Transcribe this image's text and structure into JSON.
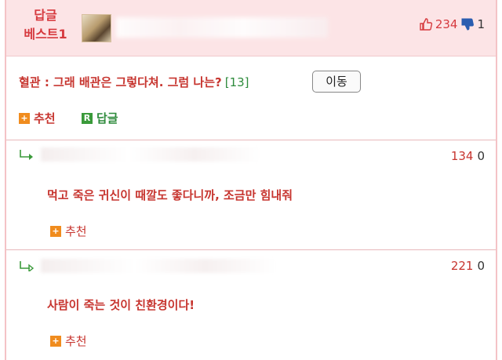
{
  "best": {
    "label_line1": "답글",
    "label_line2": "베스트1",
    "votes_up": "234",
    "votes_down": "1"
  },
  "reply": {
    "text": "혈관 : 그래 배관은 그렇다쳐. 그럼 나는?",
    "reply_count": "[13]",
    "move_button": "이동",
    "recommend_label": "추천",
    "reply_label": "답글",
    "plus_icon": "+",
    "r_icon": "R"
  },
  "subreplies": [
    {
      "text": "먹고 죽은 귀신이 때깔도 좋다니까, 조금만 힘내줘",
      "votes_up": "134",
      "votes_down": "0",
      "recommend_label": "추천",
      "plus_icon": "+"
    },
    {
      "text": "사람이 죽는 것이 친환경이다!",
      "votes_up": "221",
      "votes_down": "0",
      "recommend_label": "추천",
      "plus_icon": "+"
    }
  ],
  "colors": {
    "accent_red": "#c7352f",
    "header_bg": "#fce4e6",
    "green": "#2e8b3c",
    "orange": "#f08c1e"
  },
  "icons": [
    "thumbs-up-icon",
    "thumbs-down-icon",
    "reply-arrow-icon",
    "plus-box-icon",
    "r-box-icon"
  ]
}
